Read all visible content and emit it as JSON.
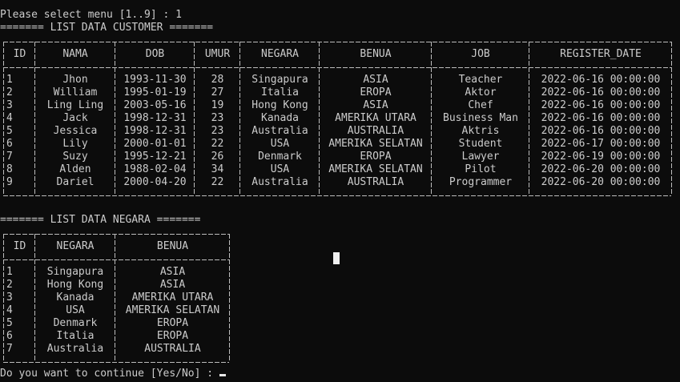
{
  "prompt_menu": "Please select menu [1..9] : 1",
  "customer_title": "======= LIST DATA CUSTOMER =======",
  "customer_headers": [
    "ID",
    "NAMA",
    "DOB",
    "UMUR",
    "NEGARA",
    "BENUA",
    "JOB",
    "REGISTER_DATE"
  ],
  "customer_rows": [
    [
      "1",
      "Jhon",
      "1993-11-30",
      "28",
      "Singapura",
      "ASIA",
      "Teacher",
      "2022-06-16 00:00:00"
    ],
    [
      "2",
      "William",
      "1995-01-19",
      "27",
      "Italia",
      "EROPA",
      "Aktor",
      "2022-06-16 00:00:00"
    ],
    [
      "3",
      "Ling Ling",
      "2003-05-16",
      "19",
      "Hong Kong",
      "ASIA",
      "Chef",
      "2022-06-16 00:00:00"
    ],
    [
      "4",
      "Jack",
      "1998-12-31",
      "23",
      "Kanada",
      "AMERIKA UTARA",
      "Business Man",
      "2022-06-16 00:00:00"
    ],
    [
      "5",
      "Jessica",
      "1998-12-31",
      "23",
      "Australia",
      "AUSTRALIA",
      "Aktris",
      "2022-06-16 00:00:00"
    ],
    [
      "6",
      "Lily",
      "2000-01-01",
      "22",
      "USA",
      "AMERIKA SELATAN",
      "Student",
      "2022-06-17 00:00:00"
    ],
    [
      "7",
      "Suzy",
      "1995-12-21",
      "26",
      "Denmark",
      "EROPA",
      "Lawyer",
      "2022-06-19 00:00:00"
    ],
    [
      "8",
      "Alden",
      "1988-02-04",
      "34",
      "USA",
      "AMERIKA SELATAN",
      "Pilot",
      "2022-06-20 00:00:00"
    ],
    [
      "9",
      "Dariel",
      "2000-04-20",
      "22",
      "Australia",
      "AUSTRALIA",
      "Programmer",
      "2022-06-20 00:00:00"
    ]
  ],
  "negara_title": "======= LIST DATA NEGARA =======",
  "negara_headers": [
    "ID",
    "NEGARA",
    "BENUA"
  ],
  "negara_rows": [
    [
      "1",
      "Singapura",
      "ASIA"
    ],
    [
      "2",
      "Hong Kong",
      "ASIA"
    ],
    [
      "3",
      "Kanada",
      "AMERIKA UTARA"
    ],
    [
      "4",
      "USA",
      "AMERIKA SELATAN"
    ],
    [
      "5",
      "Denmark",
      "EROPA"
    ],
    [
      "6",
      "Italia",
      "EROPA"
    ],
    [
      "7",
      "Australia",
      "AUSTRALIA"
    ]
  ],
  "prompt_continue": "Do you want to continue [Yes/No] : "
}
